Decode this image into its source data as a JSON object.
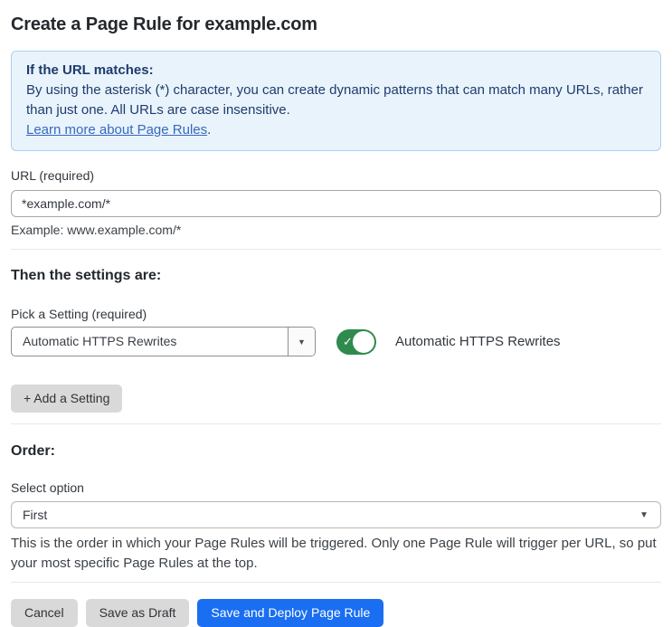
{
  "page": {
    "title": "Create a Page Rule for example.com"
  },
  "notice": {
    "heading": "If the URL matches:",
    "body": "By using the asterisk (*) character, you can create dynamic patterns that can match many URLs, rather than just one. All URLs are case insensitive.",
    "link_label": "Learn more about Page Rules",
    "link_suffix": "."
  },
  "url_field": {
    "label": "URL (required)",
    "value": "*example.com/*",
    "helper": "Example: www.example.com/*"
  },
  "settings": {
    "heading": "Then the settings are:",
    "picker_label": "Pick a Setting (required)",
    "selected_setting": "Automatic HTTPS Rewrites",
    "toggle_state": "on",
    "toggle_label": "Automatic HTTPS Rewrites",
    "add_button_label": "+ Add a Setting"
  },
  "order": {
    "heading": "Order:",
    "select_label": "Select option",
    "selected_option": "First",
    "helper": "This is the order in which your Page Rules will be triggered. Only one Page Rule will trigger per URL, so put your most specific Page Rules at the top."
  },
  "footer": {
    "cancel_label": "Cancel",
    "save_draft_label": "Save as Draft",
    "deploy_label": "Save and Deploy Page Rule"
  },
  "icons": {
    "dropdown_arrow": "▼",
    "check": "✓"
  },
  "colors": {
    "accent_blue": "#1a6ef2",
    "notice_bg": "#e9f3fc",
    "notice_border": "#abcff1",
    "notice_text": "#1e3c6d",
    "link_blue": "#3569c0",
    "toggle_green": "#2f8a4e",
    "button_gray": "#d9d9d9"
  }
}
